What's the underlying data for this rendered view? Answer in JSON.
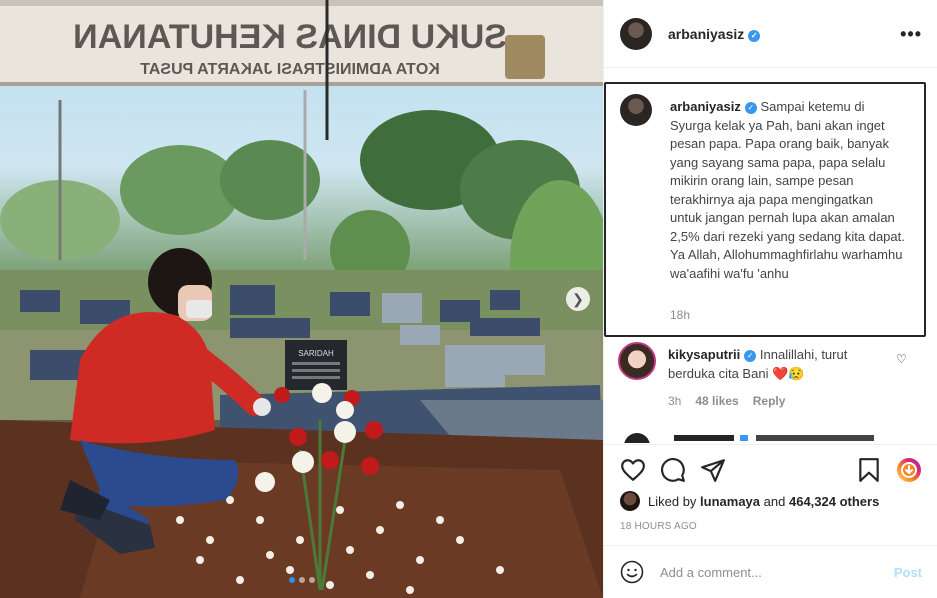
{
  "post": {
    "username": "arbaniyasiz",
    "verified": true,
    "banner_line1": "SUKU DINAS KEHUTANAN",
    "banner_line2": "KOTA ADMINISTRASI JAKARTA PUSAT",
    "grave_sign": "SARIDAH",
    "carousel_current": 1,
    "carousel_total": 3
  },
  "caption": {
    "username": "arbaniyasiz",
    "text": "Sampai ketemu di Syurga kelak ya Pah, bani akan inget pesan papa. Papa orang baik, banyak yang sayang sama papa, papa selalu mikirin orang lain, sampe pesan terakhirnya aja papa mengingatkan untuk jangan pernah lupa akan amalan 2,5% dari rezeki yang sedang kita dapat. Ya Allah, Allohummaghfirlahu warhamhu wa'aafihi wa'fu 'anhu",
    "time": "18h"
  },
  "comments": [
    {
      "username": "kikysaputrii",
      "verified": true,
      "text": "Innalillahi, turut berduka cita Bani",
      "emojis": "❤️😥",
      "time": "3h",
      "likes": "48 likes",
      "reply_label": "Reply"
    }
  ],
  "engagement": {
    "liked_by_prefix": "Liked by",
    "liked_by_user": "lunamaya",
    "liked_by_and": "and",
    "liked_by_count": "464,324 others",
    "timestamp": "18 HOURS AGO"
  },
  "add_comment": {
    "placeholder": "Add a comment...",
    "post_label": "Post"
  },
  "icons": {
    "more": "more-options-icon",
    "like": "heart-icon",
    "comment": "comment-icon",
    "share": "paper-plane-icon",
    "save": "bookmark-icon",
    "emoji": "emoji-icon",
    "next": "chevron-right-icon"
  },
  "colors": {
    "accent": "#3897f0",
    "post_disabled": "#b2dffc",
    "heart_red": "#ed4956"
  }
}
